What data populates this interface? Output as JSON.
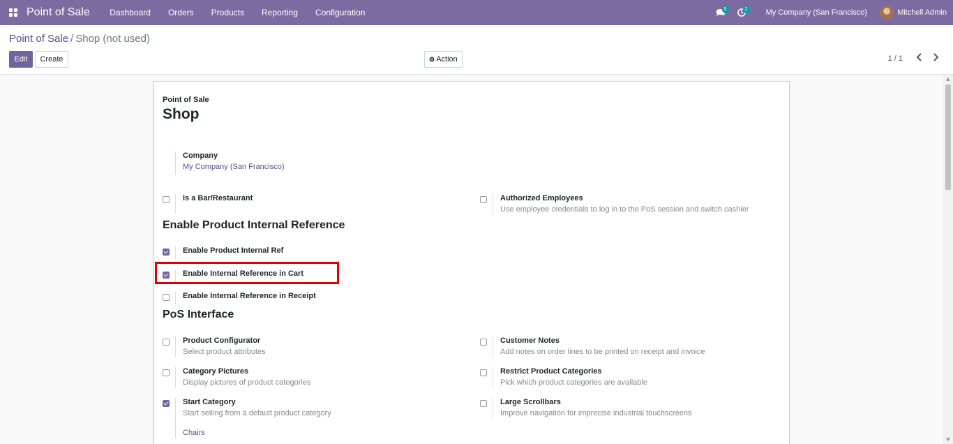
{
  "navbar": {
    "app_title": "Point of Sale",
    "menu": [
      "Dashboard",
      "Orders",
      "Products",
      "Reporting",
      "Configuration"
    ],
    "messages_count": "5",
    "activities_count": "2",
    "company": "My Company (San Francisco)",
    "user": "Mitchell Admin"
  },
  "breadcrumb": {
    "parent": "Point of Sale",
    "separator": "/",
    "current": "Shop (not used)"
  },
  "toolbar": {
    "edit_label": "Edit",
    "create_label": "Create",
    "action_label": "Action",
    "pager": "1 / 1"
  },
  "form": {
    "app_label": "Point of Sale",
    "title": "Shop",
    "company": {
      "label": "Company",
      "value": "My Company (San Francisco)"
    },
    "bar_restaurant": {
      "label": "Is a Bar/Restaurant",
      "checked": false
    },
    "authorized_employees": {
      "label": "Authorized Employees",
      "desc": "Use employee credentials to log in to the PoS session and switch cashier",
      "checked": false
    },
    "section_internal_ref": "Enable Product Internal Reference",
    "internal_ref": {
      "label": "Enable Product Internal Ref",
      "checked": true
    },
    "internal_ref_cart": {
      "label": "Enable Internal Reference in Cart",
      "checked": true
    },
    "internal_ref_receipt": {
      "label": "Enable Internal Reference in Receipt",
      "checked": false
    },
    "section_pos_interface": "PoS Interface",
    "product_configurator": {
      "label": "Product Configurator",
      "desc": "Select product attributes",
      "checked": false
    },
    "customer_notes": {
      "label": "Customer Notes",
      "desc": "Add notes on order lines to be printed on receipt and invoice",
      "checked": false
    },
    "category_pictures": {
      "label": "Category Pictures",
      "desc": "Display pictures of product categories",
      "checked": false
    },
    "restrict_categories": {
      "label": "Restrict Product Categories",
      "desc": "Pick which product categories are available",
      "checked": false
    },
    "start_category": {
      "label": "Start Category",
      "desc": "Start selling from a default product category",
      "value": "Chairs",
      "checked": true
    },
    "large_scrollbars": {
      "label": "Large Scrollbars",
      "desc": "Improve navigation for imprecise industrial touchscreens",
      "checked": false
    }
  },
  "colors": {
    "navbar": "#7c6ba1",
    "primary": "#71639e",
    "link": "#5b4b8a",
    "highlight": "#e00000"
  }
}
